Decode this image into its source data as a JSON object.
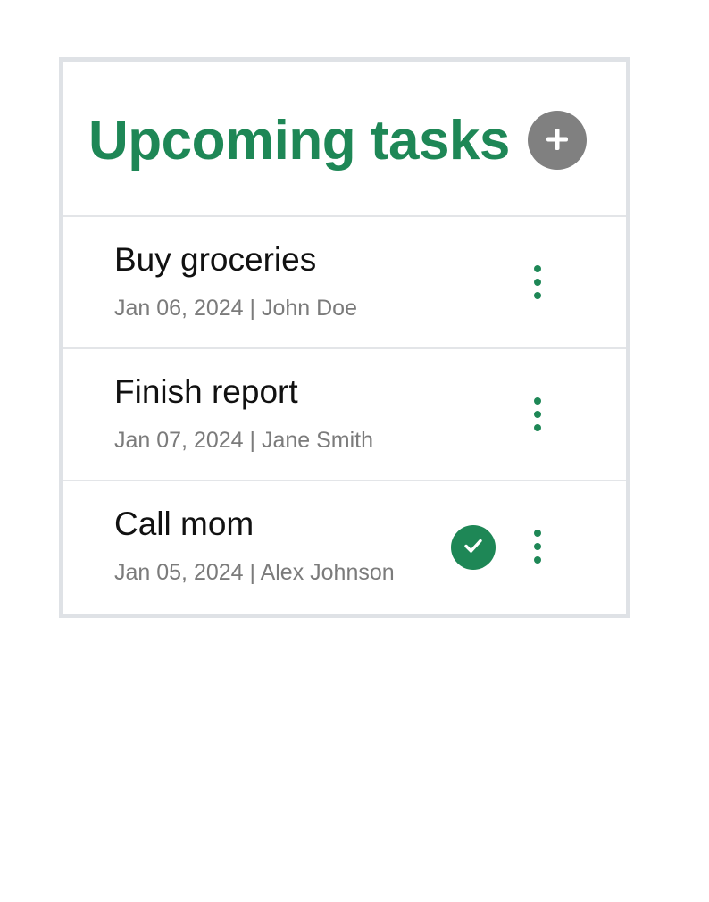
{
  "header": {
    "title": "Upcoming tasks",
    "add_icon": "plus-icon"
  },
  "tasks": [
    {
      "title": "Buy groceries",
      "meta": "Jan 06, 2024 | John Doe",
      "completed": false,
      "menu_icon": "vertical-ellipsis-icon"
    },
    {
      "title": "Finish report",
      "meta": "Jan 07, 2024 | Jane Smith",
      "completed": false,
      "menu_icon": "vertical-ellipsis-icon"
    },
    {
      "title": "Call mom",
      "meta": "Jan 05, 2024 | Alex Johnson",
      "completed": true,
      "status_icon": "checkmark-icon",
      "menu_icon": "vertical-ellipsis-icon"
    }
  ],
  "colors": {
    "accent": "#1e8756",
    "add_button": "#808080",
    "meta_text": "#7b7b7b",
    "border": "#dfe2e6"
  }
}
